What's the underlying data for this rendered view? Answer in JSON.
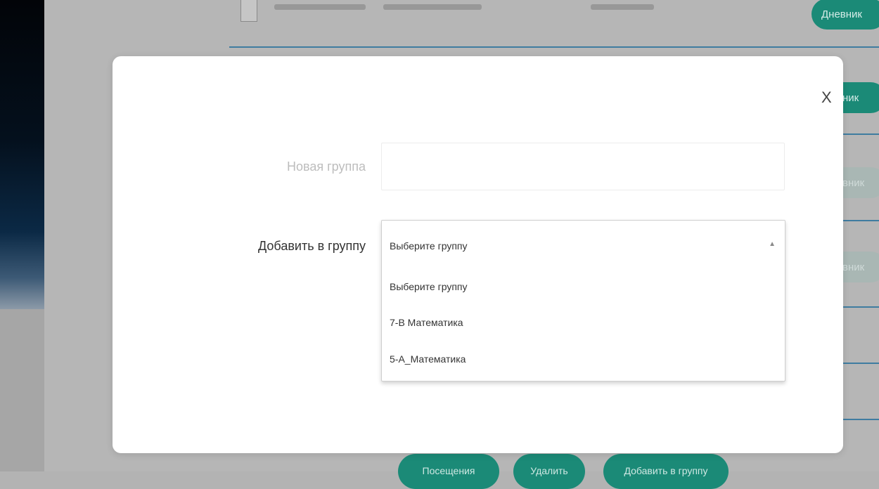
{
  "background": {
    "row_buttons": [
      "Дневник",
      "вник",
      "вник",
      "вник"
    ],
    "bottom_buttons": [
      "Посещения",
      "Удалить",
      "Добавить в группу"
    ]
  },
  "modal": {
    "close_label": "X",
    "new_group": {
      "label": "Новая группа",
      "value": ""
    },
    "add_to_group": {
      "label": "Добавить в группу",
      "selected": "Выберите группу",
      "caret": "▲",
      "options": [
        "Выберите группу",
        "7-В Математика",
        "5-А_Математика"
      ]
    }
  },
  "colors": {
    "accent": "#1b8a77",
    "divider": "#3f7ca0",
    "overlay": "#b6b6b6"
  }
}
